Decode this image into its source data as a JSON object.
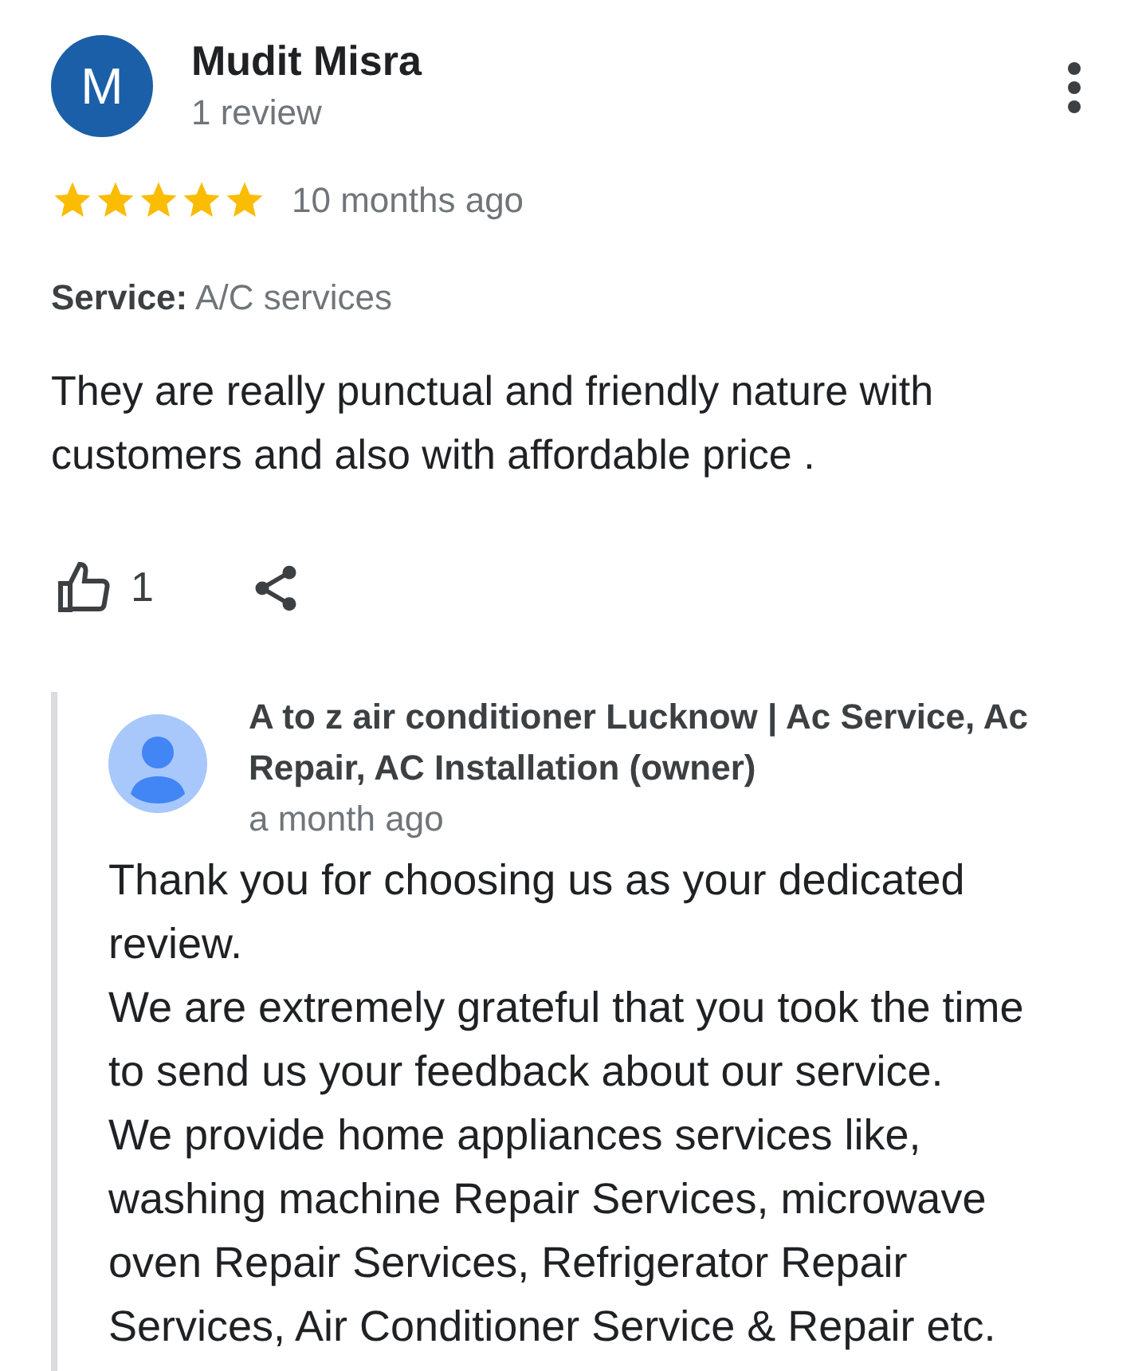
{
  "review": {
    "author": {
      "initial": "M",
      "name": "Mudit Misra",
      "meta": "1 review"
    },
    "stars": 5,
    "time": "10 months ago",
    "service": {
      "label": "Service:",
      "value": "A/C services"
    },
    "text": "They are really punctual and friendly nature with customers and also with affordable price .",
    "likes": "1"
  },
  "reply": {
    "author": "A to z air conditioner Lucknow | Ac Service, Ac Repair, AC Installation (owner)",
    "time": "a month ago",
    "lines": [
      "Thank you for choosing us as your dedicated review.",
      "We are extremely grateful that you took the time to send us your feedback about our service.",
      "We provide home appliances services like, washing machine Repair Services, microwave oven Repair Services, Refrigerator Repair Services, Air Conditioner Service & Repair etc."
    ]
  }
}
